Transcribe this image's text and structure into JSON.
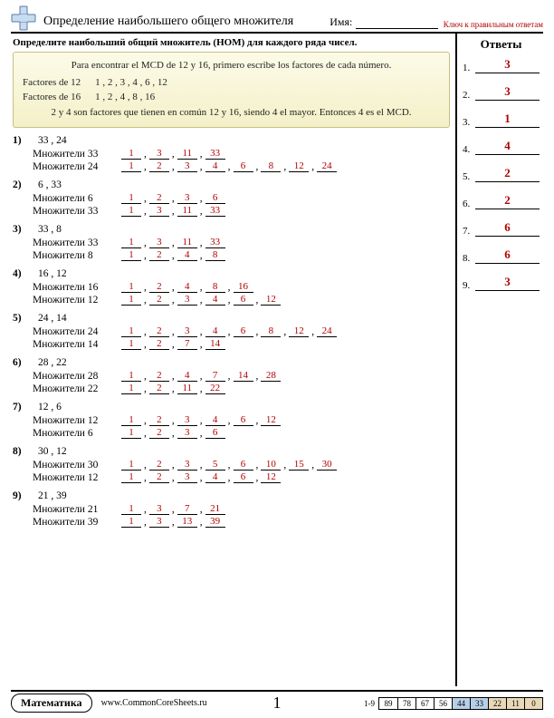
{
  "header": {
    "title": "Определение наибольшего общего множителя",
    "name_label": "Имя:",
    "key_note": "Ключ к правильным ответам"
  },
  "instruction": "Определите наибольший общий множитель (НОМ) для каждого ряда чисел.",
  "example": {
    "line1": "Para encontrar el MCD de 12 y 16, primero escribe los factores de cada número.",
    "line2a": "Factores de 12",
    "line2b": "1 ,  2 ,  3 ,  4 ,  6 , 12",
    "line3a": "Factores de 16",
    "line3b": "1 ,  2 ,  4 ,  8 , 16",
    "line4": "2 y 4 son factores que tienen en común 12 y 16, siendo 4 el mayor. Entonces 4 es el MCD."
  },
  "mul_label": "Множители",
  "problems": [
    {
      "n": "1)",
      "a": 33,
      "b": 24,
      "fa": [
        "1",
        "3",
        "11",
        "33"
      ],
      "fb": [
        "1",
        "2",
        "3",
        "4",
        "6",
        "8",
        "12",
        "24"
      ]
    },
    {
      "n": "2)",
      "a": 6,
      "b": 33,
      "fa": [
        "1",
        "2",
        "3",
        "6"
      ],
      "fb": [
        "1",
        "3",
        "11",
        "33"
      ]
    },
    {
      "n": "3)",
      "a": 33,
      "b": 8,
      "fa": [
        "1",
        "3",
        "11",
        "33"
      ],
      "fb": [
        "1",
        "2",
        "4",
        "8"
      ]
    },
    {
      "n": "4)",
      "a": 16,
      "b": 12,
      "fa": [
        "1",
        "2",
        "4",
        "8",
        "16"
      ],
      "fb": [
        "1",
        "2",
        "3",
        "4",
        "6",
        "12"
      ]
    },
    {
      "n": "5)",
      "a": 24,
      "b": 14,
      "fa": [
        "1",
        "2",
        "3",
        "4",
        "6",
        "8",
        "12",
        "24"
      ],
      "fb": [
        "1",
        "2",
        "7",
        "14"
      ]
    },
    {
      "n": "6)",
      "a": 28,
      "b": 22,
      "fa": [
        "1",
        "2",
        "4",
        "7",
        "14",
        "28"
      ],
      "fb": [
        "1",
        "2",
        "11",
        "22"
      ]
    },
    {
      "n": "7)",
      "a": 12,
      "b": 6,
      "fa": [
        "1",
        "2",
        "3",
        "4",
        "6",
        "12"
      ],
      "fb": [
        "1",
        "2",
        "3",
        "6"
      ]
    },
    {
      "n": "8)",
      "a": 30,
      "b": 12,
      "fa": [
        "1",
        "2",
        "3",
        "5",
        "6",
        "10",
        "15",
        "30"
      ],
      "fb": [
        "1",
        "2",
        "3",
        "4",
        "6",
        "12"
      ]
    },
    {
      "n": "9)",
      "a": 21,
      "b": 39,
      "fa": [
        "1",
        "3",
        "7",
        "21"
      ],
      "fb": [
        "1",
        "3",
        "13",
        "39"
      ]
    }
  ],
  "answers_title": "Ответы",
  "answers": [
    "3",
    "3",
    "1",
    "4",
    "2",
    "2",
    "6",
    "6",
    "3"
  ],
  "footer": {
    "subject": "Математика",
    "site": "www.CommonCoreSheets.ru",
    "page": "1",
    "range": "1-9",
    "scores": [
      "89",
      "78",
      "67",
      "56",
      "44",
      "33",
      "22",
      "11",
      "0"
    ]
  }
}
